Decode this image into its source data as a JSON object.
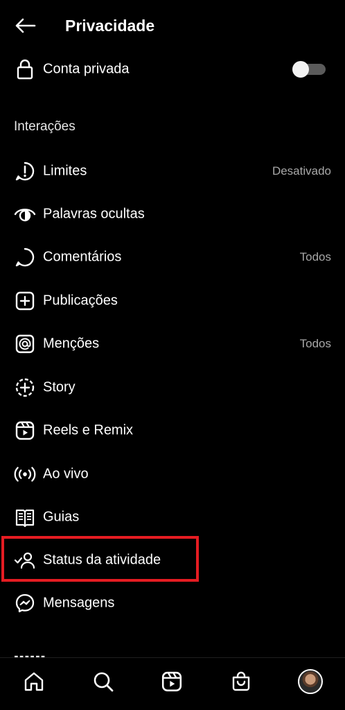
{
  "header": {
    "title": "Privacidade",
    "back_icon": "arrow-left-icon"
  },
  "account": {
    "label": "Conta privada",
    "icon": "lock-icon",
    "toggle_on": false
  },
  "section": {
    "title": "Interações",
    "items": [
      {
        "label": "Limites",
        "value": "Desativado",
        "icon": "limits-icon"
      },
      {
        "label": "Palavras ocultas",
        "value": "",
        "icon": "eye-icon"
      },
      {
        "label": "Comentários",
        "value": "Todos",
        "icon": "comment-icon"
      },
      {
        "label": "Publicações",
        "value": "",
        "icon": "plus-square-icon"
      },
      {
        "label": "Menções",
        "value": "Todos",
        "icon": "at-icon"
      },
      {
        "label": "Story",
        "value": "",
        "icon": "story-icon"
      },
      {
        "label": "Reels e Remix",
        "value": "",
        "icon": "reels-icon"
      },
      {
        "label": "Ao vivo",
        "value": "",
        "icon": "live-icon"
      },
      {
        "label": "Guias",
        "value": "",
        "icon": "guides-icon"
      },
      {
        "label": "Status da atividade",
        "value": "",
        "icon": "activity-status-icon"
      },
      {
        "label": "Mensagens",
        "value": "",
        "icon": "messenger-icon"
      }
    ]
  },
  "nav": {
    "items": [
      "home-icon",
      "search-icon",
      "reels-icon",
      "shop-icon",
      "profile-avatar"
    ]
  },
  "colors": {
    "background": "#000000",
    "highlight": "#e51c22",
    "secondary_text": "#a8a8a8"
  }
}
